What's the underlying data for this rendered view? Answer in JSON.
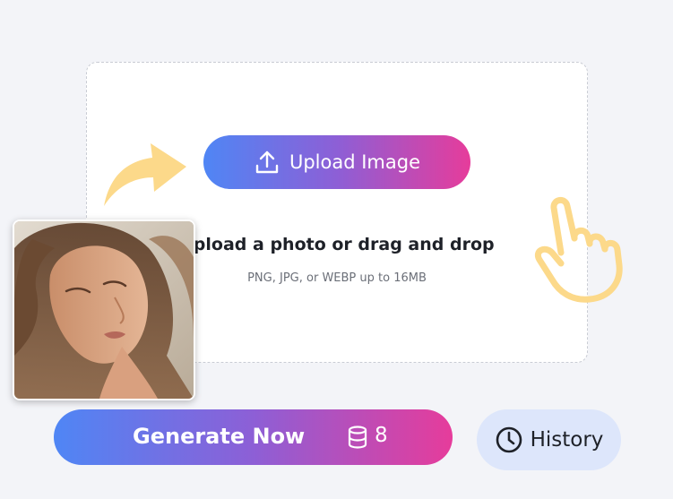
{
  "upload": {
    "button_label": "Upload Image",
    "title": "Upload a photo or drag and drop",
    "hint": "PNG, JPG, or WEBP up to 16MB",
    "button_icon": "upload-icon"
  },
  "decorations": {
    "arrow_icon": "curved-arrow-icon",
    "hand_icon": "pointing-hand-icon",
    "accent_yellow": "#fcd98a"
  },
  "sample_image": {
    "subject": "sample-portrait"
  },
  "actions": {
    "generate_label": "Generate Now",
    "credits_icon": "database-icon",
    "credits_count": "8",
    "history_label": "History",
    "history_icon": "clock-icon"
  },
  "colors": {
    "gradient_start": "#4f86f5",
    "gradient_mid": "#8d5fd6",
    "gradient_end": "#e63c9b",
    "history_bg": "#dde6fb",
    "page_bg": "#f3f4f8"
  }
}
